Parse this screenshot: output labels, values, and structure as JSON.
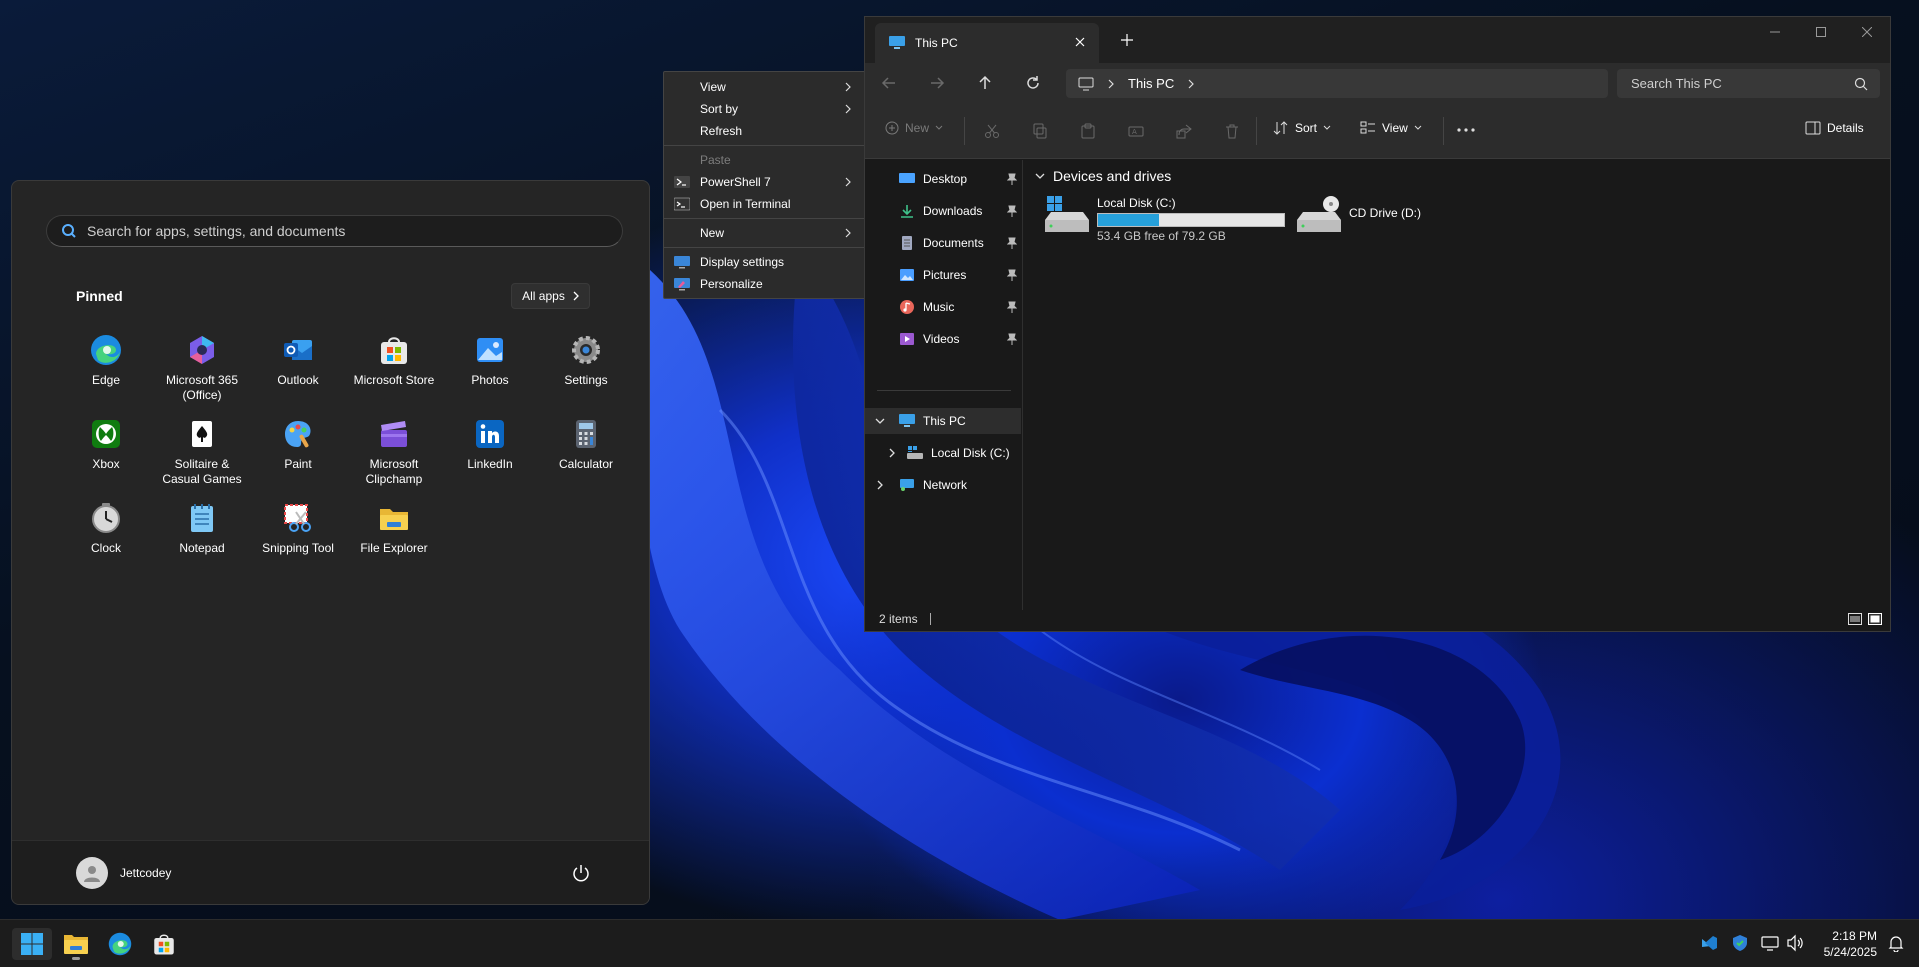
{
  "start_menu": {
    "search_placeholder": "Search for apps, settings, and documents",
    "pinned_label": "Pinned",
    "all_apps_label": "All apps",
    "apps": [
      {
        "name": "Edge",
        "icon": "edge-icon"
      },
      {
        "name": "Microsoft 365 (Office)",
        "icon": "microsoft-365-icon"
      },
      {
        "name": "Outlook",
        "icon": "outlook-icon"
      },
      {
        "name": "Microsoft Store",
        "icon": "store-icon"
      },
      {
        "name": "Photos",
        "icon": "photos-icon"
      },
      {
        "name": "Settings",
        "icon": "settings-gear-icon"
      },
      {
        "name": "Xbox",
        "icon": "xbox-icon"
      },
      {
        "name": "Solitaire & Casual Games",
        "icon": "solitaire-icon"
      },
      {
        "name": "Paint",
        "icon": "paint-icon"
      },
      {
        "name": "Microsoft Clipchamp",
        "icon": "clipchamp-icon"
      },
      {
        "name": "LinkedIn",
        "icon": "linkedin-icon"
      },
      {
        "name": "Calculator",
        "icon": "calculator-icon"
      },
      {
        "name": "Clock",
        "icon": "clock-icon"
      },
      {
        "name": "Notepad",
        "icon": "notepad-icon"
      },
      {
        "name": "Snipping Tool",
        "icon": "snipping-tool-icon"
      },
      {
        "name": "File Explorer",
        "icon": "folder-icon"
      }
    ],
    "user_name": "Jettcodey"
  },
  "context_menu": {
    "items": [
      {
        "label": "View",
        "submenu": true
      },
      {
        "label": "Sort by",
        "submenu": true
      },
      {
        "label": "Refresh"
      },
      {
        "label": "Paste",
        "disabled": true
      },
      {
        "label": "PowerShell 7",
        "submenu": true,
        "icon": "powershell-icon"
      },
      {
        "label": "Open in Terminal",
        "icon": "terminal-icon"
      },
      {
        "label": "New",
        "submenu": true
      },
      {
        "label": "Display settings",
        "icon": "display-icon"
      },
      {
        "label": "Personalize",
        "icon": "personalize-icon"
      }
    ]
  },
  "explorer": {
    "tab_title": "This PC",
    "address_crumb": "This PC",
    "search_placeholder": "Search This PC",
    "toolbar": {
      "new": "New",
      "sort": "Sort",
      "view": "View",
      "details": "Details"
    },
    "nav_items": [
      {
        "label": "Desktop",
        "icon": "desktop-icon",
        "color": "#4aa3ff"
      },
      {
        "label": "Downloads",
        "icon": "download-icon",
        "color": "#3fc18a"
      },
      {
        "label": "Documents",
        "icon": "documents-icon",
        "color": "#a0a8c0"
      },
      {
        "label": "Pictures",
        "icon": "pictures-icon",
        "color": "#4a9eff"
      },
      {
        "label": "Music",
        "icon": "music-icon",
        "color": "#e9665a"
      },
      {
        "label": "Videos",
        "icon": "videos-icon",
        "color": "#9b59d0"
      }
    ],
    "tree": {
      "this_pc": "This PC",
      "local_disk": "Local Disk (C:)",
      "network": "Network"
    },
    "group_title": "Devices and drives",
    "drives": [
      {
        "name": "Local Disk (C:)",
        "free_text": "53.4 GB free of 79.2 GB",
        "used_fraction": 0.326
      },
      {
        "name": "CD Drive (D:)"
      }
    ],
    "status": "2 items"
  },
  "taskbar": {
    "time": "2:18 PM",
    "date": "5/24/2025"
  },
  "colors": {
    "accent": "#26a0da",
    "start_bg": "#252525",
    "explorer_bg": "#191919"
  }
}
